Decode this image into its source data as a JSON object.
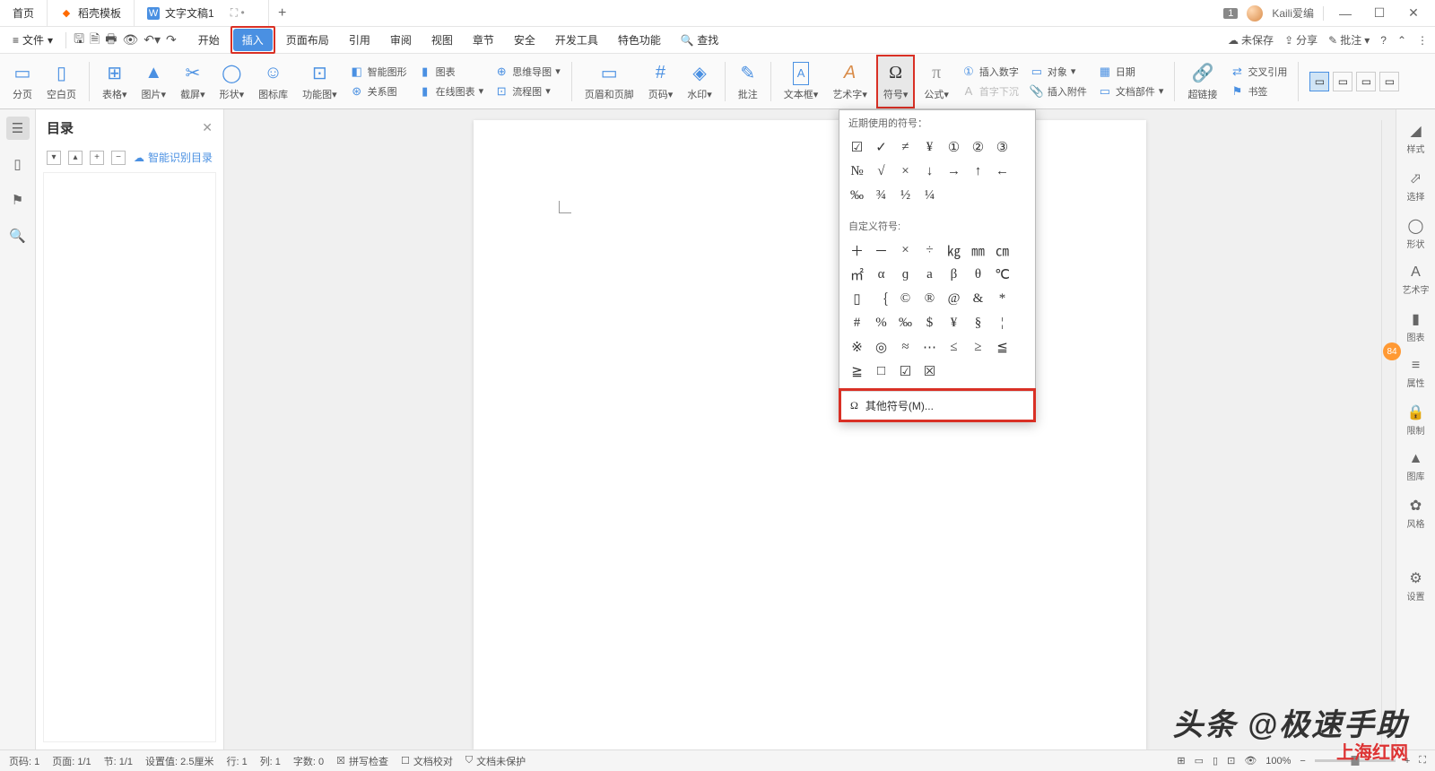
{
  "titlebar": {
    "tabs": [
      {
        "label": "首页",
        "icon": "",
        "color": "#4a90e2"
      },
      {
        "label": "稻壳模板",
        "icon": "◆",
        "color": "#ff6a00"
      },
      {
        "label": "文字文稿1",
        "icon": "W",
        "color": "#4a90e2"
      }
    ],
    "badge": "1",
    "username": "Kaili爱编"
  },
  "menubar": {
    "file": "文件",
    "tabs": [
      "开始",
      "插入",
      "页面布局",
      "引用",
      "审阅",
      "视图",
      "章节",
      "安全",
      "开发工具",
      "特色功能"
    ],
    "active_index": 1,
    "search": "查找",
    "right": {
      "unsaved": "未保存",
      "share": "分享",
      "annotate": "批注"
    }
  },
  "ribbon": {
    "items_big": [
      {
        "label": "分页",
        "icon": "▭"
      },
      {
        "label": "空白页",
        "icon": "▯"
      },
      {
        "label": "表格",
        "icon": "⊞"
      },
      {
        "label": "图片",
        "icon": "▲"
      },
      {
        "label": "截屏",
        "icon": "✂"
      },
      {
        "label": "形状",
        "icon": "◯"
      },
      {
        "label": "图标库",
        "icon": "☺"
      },
      {
        "label": "功能图",
        "icon": "⊡"
      }
    ],
    "col1": [
      {
        "label": "智能图形",
        "icon": "◧"
      },
      {
        "label": "关系图",
        "icon": "⊛"
      }
    ],
    "col2": [
      {
        "label": "图表",
        "icon": "📊"
      },
      {
        "label": "在线图表",
        "icon": "📈"
      }
    ],
    "col3": [
      {
        "label": "思维导图",
        "icon": "⊕"
      },
      {
        "label": "流程图",
        "icon": "⊡"
      }
    ],
    "items_big2": [
      {
        "label": "页眉和页脚",
        "icon": "▭"
      },
      {
        "label": "页码",
        "icon": "#"
      },
      {
        "label": "水印",
        "icon": "◈"
      },
      {
        "label": "批注",
        "icon": "✎"
      },
      {
        "label": "文本框",
        "icon": "A"
      },
      {
        "label": "艺术字",
        "icon": "A"
      },
      {
        "label": "符号",
        "icon": "Ω"
      },
      {
        "label": "公式",
        "icon": "π"
      }
    ],
    "col4": [
      {
        "label": "插入数字",
        "icon": "①"
      },
      {
        "label": "首字下沉",
        "icon": "A"
      }
    ],
    "col5": [
      {
        "label": "对象",
        "icon": "▭"
      },
      {
        "label": "插入附件",
        "icon": "📎"
      }
    ],
    "col6": [
      {
        "label": "日期",
        "icon": "📅"
      },
      {
        "label": "文档部件",
        "icon": "▭"
      }
    ],
    "items_big3": [
      {
        "label": "超链接",
        "icon": "🔗"
      }
    ],
    "col7": [
      {
        "label": "交叉引用",
        "icon": "⇄"
      },
      {
        "label": "书签",
        "icon": "⚑"
      }
    ]
  },
  "nav": {
    "title": "目录",
    "smart": "智能识别目录"
  },
  "rightbar": [
    "样式",
    "选择",
    "形状",
    "艺术字",
    "图表",
    "属性",
    "限制",
    "图库",
    "风格",
    "",
    "设置"
  ],
  "symbol_dd": {
    "recent_title": "近期使用的符号：",
    "recent": [
      "☑",
      "✓",
      "≠",
      "¥",
      "①",
      "②",
      "③",
      "№",
      "√",
      "×",
      "↓",
      "→",
      "↑",
      "←",
      "‰",
      "¾",
      "½",
      "¼"
    ],
    "custom_title": "自定义符号:",
    "custom": [
      "＋",
      "－",
      "×",
      "÷",
      "㎏",
      "㎜",
      "㎝",
      "㎡",
      "α",
      "ɡ",
      "a",
      "β",
      "θ",
      "℃",
      "▯",
      "｛",
      "©",
      "®",
      "@",
      "&",
      "*",
      "#",
      "%",
      "‰",
      "$",
      "¥",
      "§",
      "¦",
      "※",
      "◎",
      "≈",
      "⋯",
      "≤",
      "≥",
      "≦",
      "≧",
      "□",
      "☑",
      "☒"
    ],
    "more": "其他符号(M)..."
  },
  "statusbar": {
    "page_no": "页码: 1",
    "page": "页面: 1/1",
    "section": "节: 1/1",
    "setting": "设置值: 2.5厘米",
    "line": "行: 1",
    "col": "列: 1",
    "chars": "字数: 0",
    "spellcheck": "拼写检查",
    "proofing": "文档校对",
    "protect": "文档未保护",
    "zoom": "100%"
  },
  "watermark": "头条 @极速手助",
  "watermark2": "上海红网"
}
